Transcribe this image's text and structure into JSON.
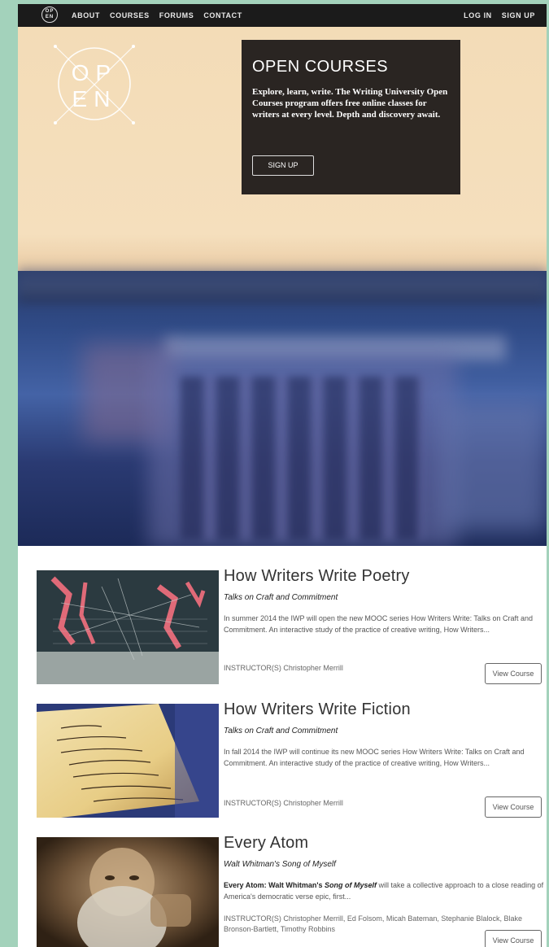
{
  "nav": {
    "logo_text": "OP EN",
    "left_links": [
      "ABOUT",
      "COURSES",
      "FORUMS",
      "CONTACT"
    ],
    "right_links": [
      "LOG IN",
      "SIGN UP"
    ]
  },
  "hero": {
    "logo_text_top": "OP",
    "logo_text_bottom": "EN",
    "card_title": "OPEN COURSES",
    "card_text": "Explore, learn, write. The Writing University Open Courses program offers free online classes for writers at every level. Depth and discovery await.",
    "signup_label": "SIGN UP"
  },
  "courses": [
    {
      "title": "How Writers Write Poetry",
      "subtitle": "Talks on Craft and Commitment",
      "desc": "In summer 2014 the IWP will open the new MOOC series How Writers Write: Talks on Craft and Commitment. An interactive study of the practice of creative writing, How Writers...",
      "instructors": "INSTRUCTOR(S) Christopher Merrill",
      "button": "View Course"
    },
    {
      "title": "How Writers Write Fiction",
      "subtitle": "Talks on Craft and Commitment",
      "desc": "In fall 2014 the IWP will continue its new MOOC series How Writers Write: Talks on Craft and Commitment. An interactive study of the practice of creative writing, How Writers...",
      "instructors": "INSTRUCTOR(S) Christopher Merrill",
      "button": "View Course"
    },
    {
      "title": "Every Atom",
      "subtitle": "Walt Whitman's Song of Myself",
      "desc_bold1": "Every Atom: Walt Whitman's ",
      "desc_bold_italic": "Song of Myself",
      "desc_rest": " will take a collective approach to a close reading of America's democratic verse epic, first...",
      "instructors": "INSTRUCTOR(S) Christopher Merrill, Ed Folsom, Micah Bateman, Stephanie Blalock, Blake Bronson-Bartlett, Timothy Robbins",
      "button": "View Course"
    }
  ],
  "colors": {
    "nav_bg": "#1b1b1b",
    "card_bg": "#2a2522",
    "side_bg": "#a3d2bb"
  }
}
